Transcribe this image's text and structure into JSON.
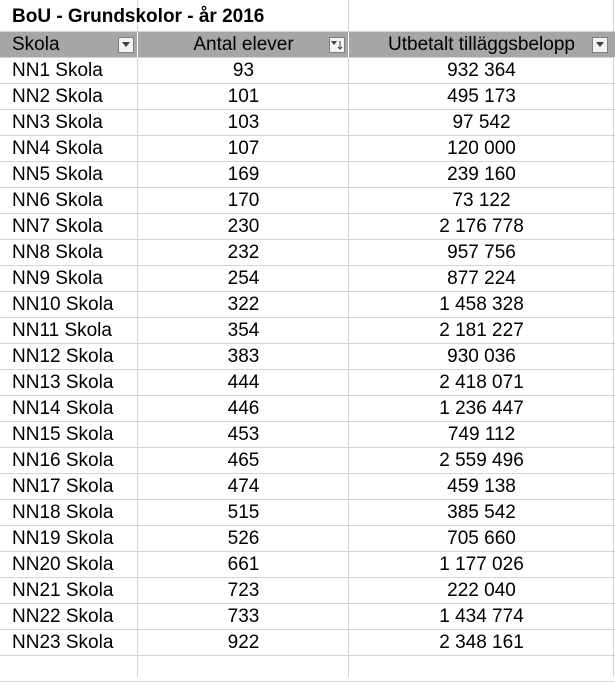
{
  "sheet": {
    "title": "BoU - Grundskolor - år 2016",
    "headers": [
      "Skola",
      "Antal elever",
      "Utbetalt tilläggsbelopp"
    ],
    "filter_icons": [
      "filter-dropdown-icon",
      "sorted-ascending-filter-icon",
      "filter-dropdown-icon"
    ],
    "rows": [
      [
        "NN1 Skola",
        "93",
        "932 364"
      ],
      [
        "NN2 Skola",
        "101",
        "495 173"
      ],
      [
        "NN3 Skola",
        "103",
        "97 542"
      ],
      [
        "NN4 Skola",
        "107",
        "120 000"
      ],
      [
        "NN5 Skola",
        "169",
        "239 160"
      ],
      [
        "NN6 Skola",
        "170",
        "73 122"
      ],
      [
        "NN7 Skola",
        "230",
        "2 176 778"
      ],
      [
        "NN8 Skola",
        "232",
        "957 756"
      ],
      [
        "NN9 Skola",
        "254",
        "877 224"
      ],
      [
        "NN10 Skola",
        "322",
        "1 458 328"
      ],
      [
        "NN11 Skola",
        "354",
        "2 181 227"
      ],
      [
        "NN12 Skola",
        "383",
        "930 036"
      ],
      [
        "NN13 Skola",
        "444",
        "2 418 071"
      ],
      [
        "NN14 Skola",
        "446",
        "1 236 447"
      ],
      [
        "NN15 Skola",
        "453",
        "749 112"
      ],
      [
        "NN16 Skola",
        "465",
        "2 559 496"
      ],
      [
        "NN17 Skola",
        "474",
        "459 138"
      ],
      [
        "NN18 Skola",
        "515",
        "385 542"
      ],
      [
        "NN19 Skola",
        "526",
        "705 660"
      ],
      [
        "NN20 Skola",
        "661",
        "1 177 026"
      ],
      [
        "NN21 Skola",
        "723",
        "222 040"
      ],
      [
        "NN22 Skola",
        "733",
        "1 434 774"
      ],
      [
        "NN23 Skola",
        "922",
        "2 348 161"
      ]
    ],
    "colors": {
      "header_bg": "#a6a6a6",
      "gridline": "#d4d4d4"
    }
  }
}
